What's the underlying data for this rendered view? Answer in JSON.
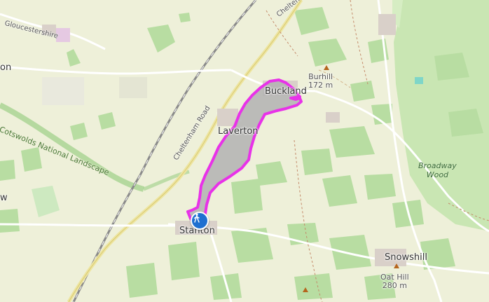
{
  "map": {
    "places": {
      "buckland": "Buckland",
      "laverton": "Laverton",
      "stanton": "Stanton",
      "snowshill": "Snowshill",
      "left_edge_town": "on",
      "left_edge_w": "w"
    },
    "hills": {
      "burhill_name": "Burhill",
      "burhill_height": "172 m",
      "oat_hill_name": "Oat Hill",
      "oat_hill_height": "280 m"
    },
    "woods": {
      "broadway_wood_line1": "Broadway",
      "broadway_wood_line2": "Wood"
    },
    "roads": {
      "gloucestershire": "Gloucestershire",
      "cheltenham_road": "Cheltenham Road",
      "cheltenham_top": "Chelten"
    },
    "areas": {
      "cotswolds": "Cotswolds National Landscape"
    },
    "route": {
      "color": "#e832e8",
      "fill": "#b2b2b2"
    },
    "marker": {
      "icon": "hiker-icon",
      "color": "#1e6fd0"
    }
  }
}
